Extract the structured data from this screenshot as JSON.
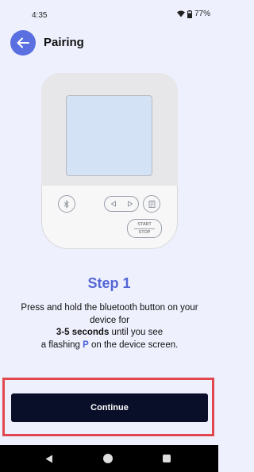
{
  "status_bar": {
    "time": "4:35",
    "battery": "77%",
    "icons": [
      "wifi-icon",
      "battery-icon"
    ]
  },
  "header": {
    "title": "Pairing",
    "back_icon": "arrow-left-icon"
  },
  "device": {
    "start_label": "START",
    "stop_label": "STOP",
    "buttons": [
      "bluetooth-icon",
      "left-arrow-icon",
      "right-arrow-icon",
      "memory-icon"
    ]
  },
  "step": {
    "title": "Step 1",
    "line1": "Press and hold the bluetooth button on your device for",
    "bold_duration": "3-5 seconds",
    "line3_mid": " until you see",
    "line4_pre": "a flashing ",
    "flashing_letter": "P",
    "line4_post": " on the device screen."
  },
  "actions": {
    "continue_label": "Continue"
  },
  "colors": {
    "accent": "#5a6fe0",
    "step_title": "#5466d6",
    "button_bg": "#0a0f29",
    "highlight_frame": "#e0474f",
    "background": "#eef0fd"
  }
}
